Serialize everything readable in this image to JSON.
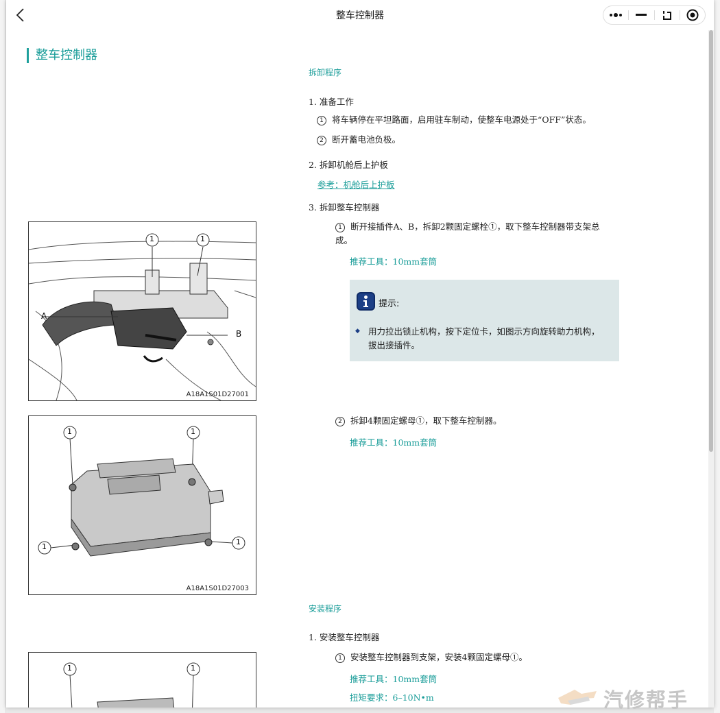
{
  "window": {
    "title": "整车控制器",
    "capsule": [
      "more-icon",
      "minimize-icon",
      "restore-icon",
      "close-target-icon"
    ]
  },
  "page": {
    "heading": "整车控制器",
    "removal": {
      "title": "拆卸程序",
      "step1": "1. 准备工作",
      "step1_sub1": "将车辆停在平坦路面，启用驻车制动，使整车电源处于“OFF”状态。",
      "step1_sub2": "断开蓄电池负极。",
      "step2": "2. 拆卸机舱后上护板",
      "step2_ref": "参考：机舱后上护板",
      "step3": "3. 拆卸整车控制器",
      "step3_sub1": "断开接插件A、B，拆卸2颗固定螺栓①，取下整车控制器带支架总成。",
      "step3_tool1": "推荐工具：10mm套筒",
      "hint_title": "提示:",
      "hint_text": "用力拉出锁止机构，按下定位卡，如图示方向旋转助力机构，拔出接插件。",
      "step3_sub2": "拆卸4颗固定螺母①，取下整车控制器。",
      "step3_tool2": "推荐工具：10mm套筒"
    },
    "install": {
      "title": "安装程序",
      "step1": "1. 安装整车控制器",
      "step1_sub1": "安装整车控制器到支架，安装4颗固定螺母①。",
      "tool": "推荐工具：10mm套筒",
      "torque": "扭矩要求：6–10N•m"
    },
    "figures": {
      "fig1_code": "A18A1S01D27001",
      "fig2_code": "A18A1S01D27003",
      "callout_1": "1",
      "callout_a": "A",
      "callout_b": "B"
    },
    "circled": {
      "one": "1",
      "two": "2"
    }
  },
  "watermark": "汽修帮手",
  "colors": {
    "accent": "#1a9d99",
    "hint_bg": "#dce7e8",
    "hint_icon": "#1c3f86"
  }
}
